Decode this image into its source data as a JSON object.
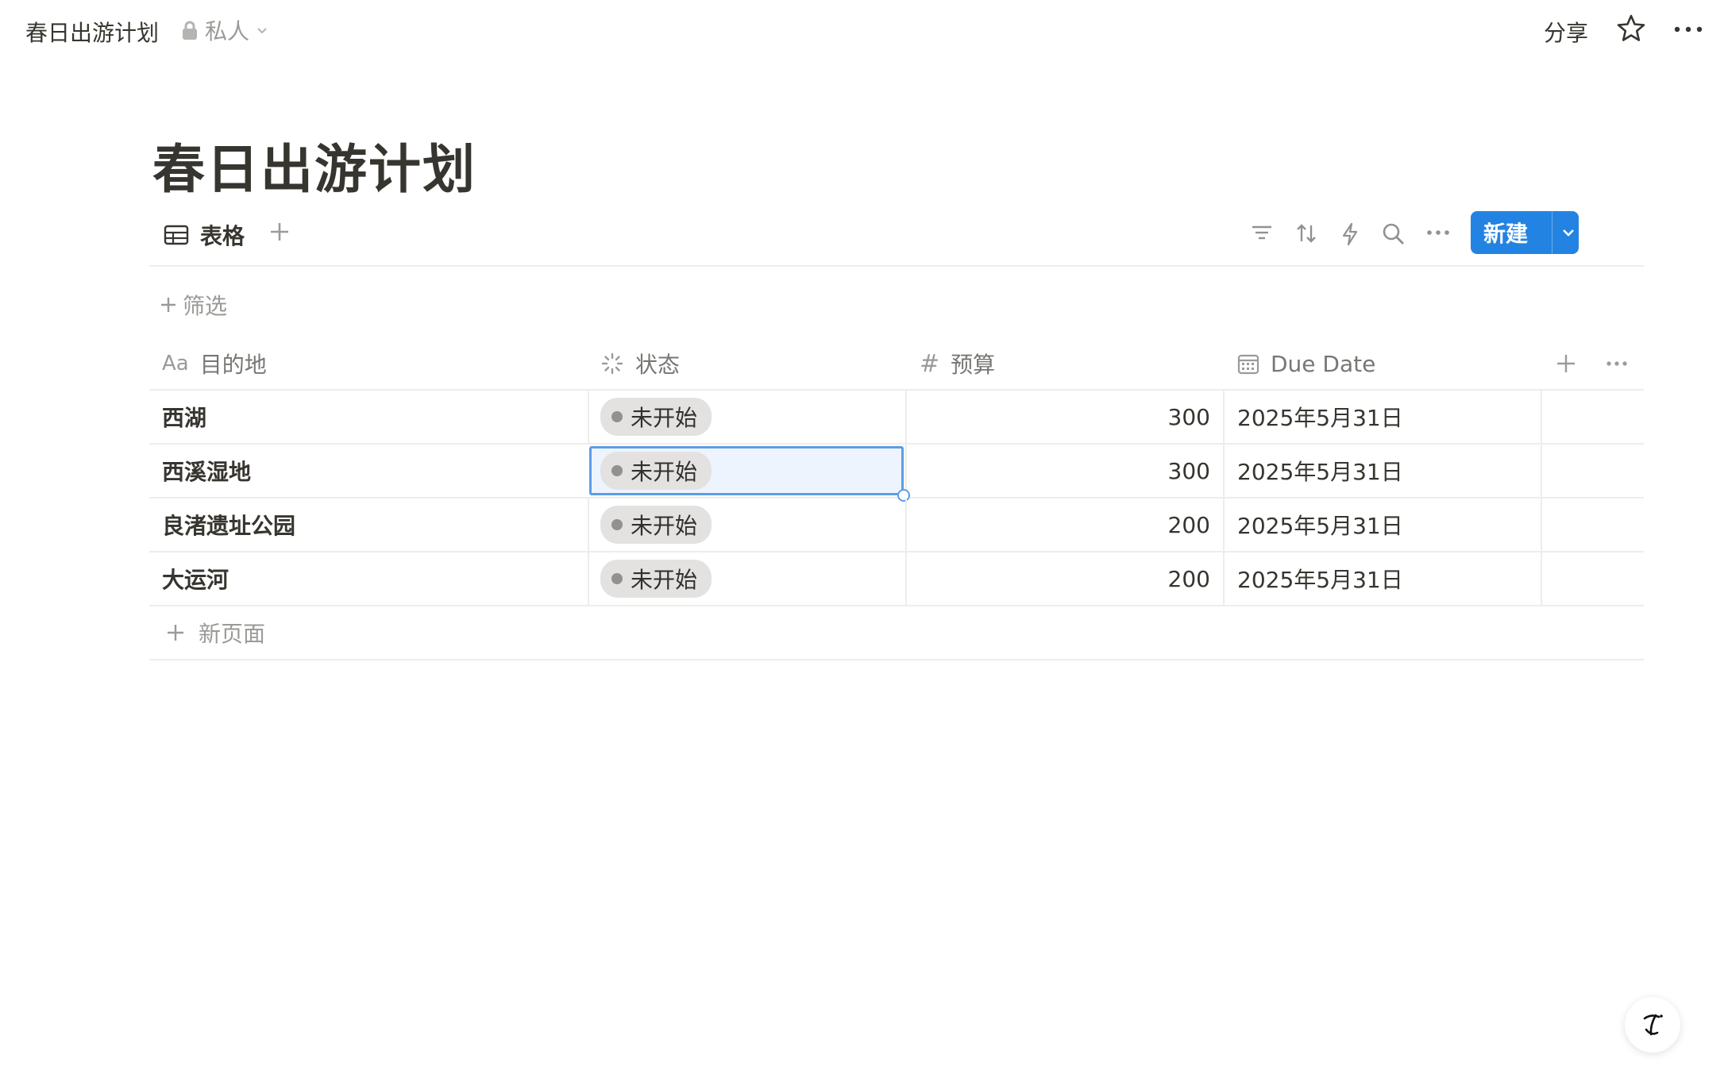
{
  "topbar": {
    "page_title": "春日出游计划",
    "privacy_label": "私人",
    "share_label": "分享"
  },
  "page": {
    "title": "春日出游计划"
  },
  "view": {
    "tab_label": "表格",
    "new_button_label": "新建",
    "filter_label": "筛选"
  },
  "table": {
    "columns": [
      {
        "label": "目的地",
        "icon": "Aa"
      },
      {
        "label": "状态",
        "icon": "status-icon"
      },
      {
        "label": "预算",
        "icon": "#"
      },
      {
        "label": "Due Date",
        "icon": "calendar-icon"
      }
    ],
    "rows": [
      {
        "name": "西湖",
        "status": "未开始",
        "budget": "300",
        "due": "2025年5月31日"
      },
      {
        "name": "西溪湿地",
        "status": "未开始",
        "budget": "300",
        "due": "2025年5月31日"
      },
      {
        "name": "良渚遗址公园",
        "status": "未开始",
        "budget": "200",
        "due": "2025年5月31日"
      },
      {
        "name": "大运河",
        "status": "未开始",
        "budget": "200",
        "due": "2025年5月31日"
      }
    ],
    "new_page_label": "新页面",
    "selected_row_index": 1
  },
  "colors": {
    "accent": "#2383e2",
    "selection_border": "#5d9ce6",
    "status_pill_bg": "#e3e2e0",
    "text": "#37352f",
    "muted": "#9b9a97"
  }
}
